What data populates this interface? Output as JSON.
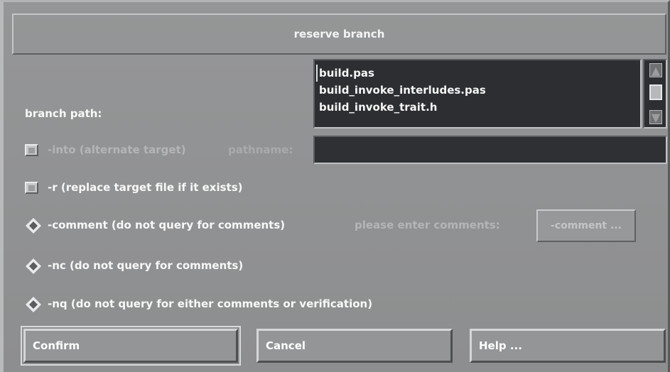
{
  "dialog": {
    "title": "reserve branch"
  },
  "branch_path": {
    "label": "branch path:",
    "files": [
      "build.pas",
      "build_invoke_interludes.pas",
      "build_invoke_trait.h"
    ]
  },
  "options": {
    "into_label": "-into (alternate target)",
    "pathname_label": "pathname:",
    "pathname_value": "",
    "replace_label": "-r (replace target file if it exists)",
    "comment_label": "-comment (do not query for comments)",
    "comment_prompt": "please enter comments:",
    "comment_button": "-comment ...",
    "nc_label": "-nc (do not query for comments)",
    "nq_label": "-nq (do not query for either comments or verification)"
  },
  "buttons": {
    "confirm": "Confirm",
    "cancel": "Cancel",
    "help": "Help ..."
  },
  "scrollbar": {
    "up_icon": "arrow-up",
    "down_icon": "arrow-down"
  }
}
